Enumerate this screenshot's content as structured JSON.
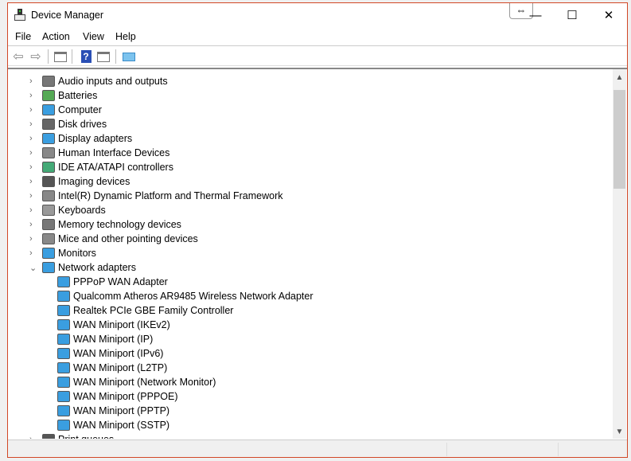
{
  "window": {
    "title": "Device Manager",
    "snap_icon": "⇔",
    "minimize": "—",
    "maximize": "☐",
    "close": "✕"
  },
  "menu": [
    "File",
    "Action",
    "View",
    "Help"
  ],
  "toolbar": [
    "back-icon",
    "forward-icon",
    "show-hide-console-tree-icon",
    "help-icon",
    "show-action-pane-icon",
    "scan-hardware-icon"
  ],
  "tree": {
    "categories": [
      {
        "label": "Audio inputs and outputs",
        "icon": "speaker-icon"
      },
      {
        "label": "Batteries",
        "icon": "battery-icon"
      },
      {
        "label": "Computer",
        "icon": "computer-icon"
      },
      {
        "label": "Disk drives",
        "icon": "disk-icon"
      },
      {
        "label": "Display adapters",
        "icon": "display-adapter-icon"
      },
      {
        "label": "Human Interface Devices",
        "icon": "hid-icon"
      },
      {
        "label": "IDE ATA/ATAPI controllers",
        "icon": "ide-icon"
      },
      {
        "label": "Imaging devices",
        "icon": "camera-icon"
      },
      {
        "label": "Intel(R) Dynamic Platform and Thermal Framework",
        "icon": "intel-icon"
      },
      {
        "label": "Keyboards",
        "icon": "keyboard-icon"
      },
      {
        "label": "Memory technology devices",
        "icon": "memory-icon"
      },
      {
        "label": "Mice and other pointing devices",
        "icon": "mouse-icon"
      },
      {
        "label": "Monitors",
        "icon": "monitor-icon"
      },
      {
        "label": "Network adapters",
        "icon": "network-icon",
        "expanded": true
      }
    ],
    "network_children": [
      "PPPoP WAN Adapter",
      "Qualcomm Atheros AR9485 Wireless Network Adapter",
      "Realtek PCIe GBE Family Controller",
      "WAN Miniport (IKEv2)",
      "WAN Miniport (IP)",
      "WAN Miniport (IPv6)",
      "WAN Miniport (L2TP)",
      "WAN Miniport (Network Monitor)",
      "WAN Miniport (PPPOE)",
      "WAN Miniport (PPTP)",
      "WAN Miniport (SSTP)"
    ],
    "after": [
      {
        "label": "Print queues",
        "icon": "printer-icon"
      }
    ]
  }
}
